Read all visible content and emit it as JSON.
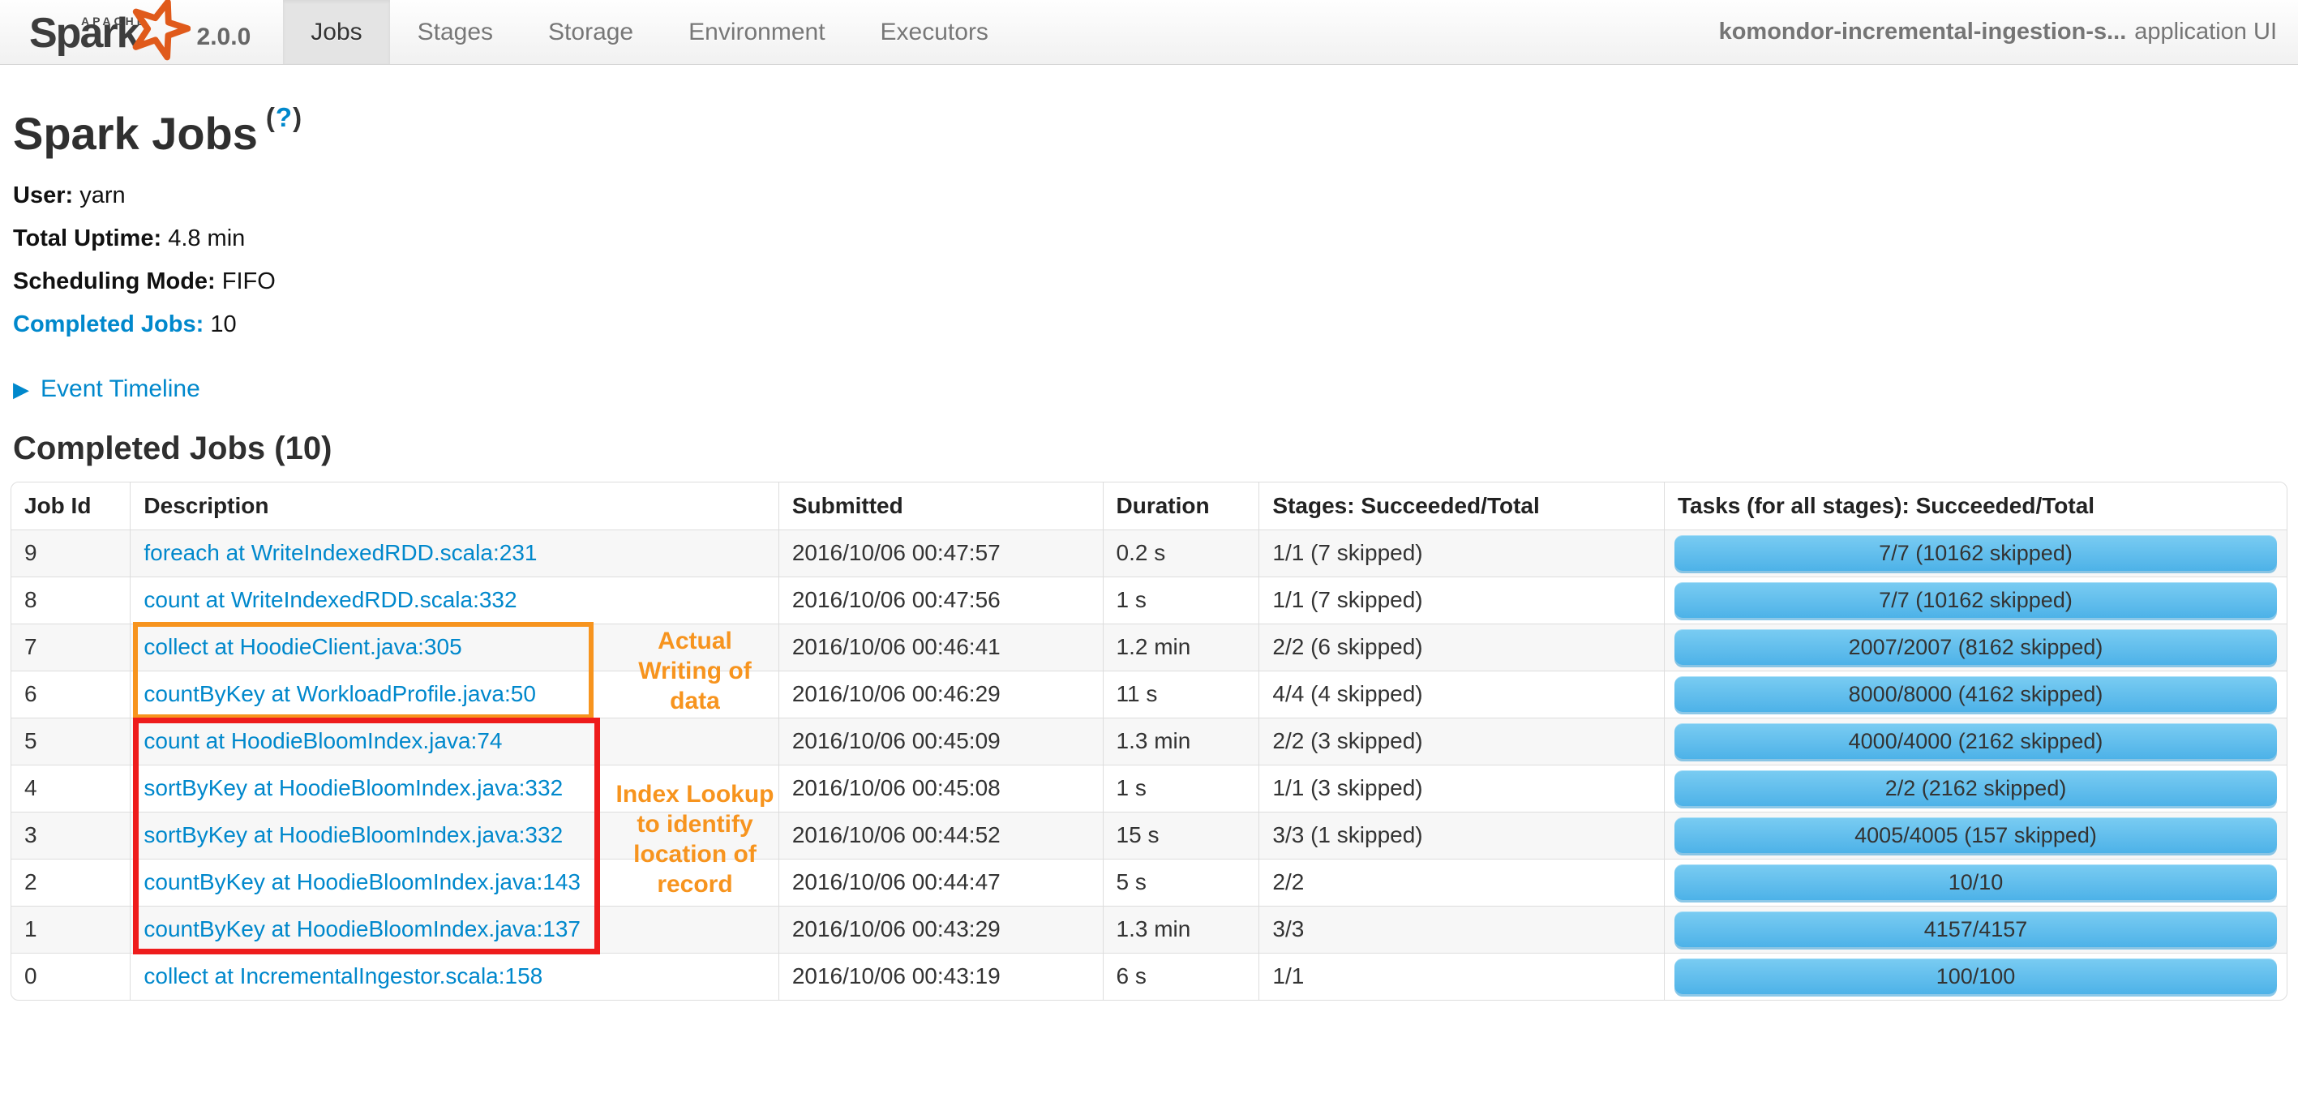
{
  "nav": {
    "logo": {
      "apache": "APACHE",
      "name": "Spark",
      "tm": "™",
      "version": "2.0.0"
    },
    "tabs": [
      {
        "label": "Jobs",
        "active": true
      },
      {
        "label": "Stages",
        "active": false
      },
      {
        "label": "Storage",
        "active": false
      },
      {
        "label": "Environment",
        "active": false
      },
      {
        "label": "Executors",
        "active": false
      }
    ],
    "app_name": "komondor-incremental-ingestion-s...",
    "app_suffix": "application UI"
  },
  "page": {
    "title": "Spark Jobs",
    "help": {
      "open": "(",
      "q": "?",
      "close": ")"
    },
    "info": {
      "user_label": "User:",
      "user_value": "yarn",
      "uptime_label": "Total Uptime:",
      "uptime_value": "4.8 min",
      "scheduling_label": "Scheduling Mode:",
      "scheduling_value": "FIFO",
      "completed_label": "Completed Jobs:",
      "completed_value": "10"
    },
    "event_timeline": {
      "arrow": "▶",
      "label": "Event Timeline"
    },
    "section_title": "Completed Jobs (10)"
  },
  "table": {
    "headers": [
      "Job Id",
      "Description",
      "Submitted",
      "Duration",
      "Stages: Succeeded/Total",
      "Tasks (for all stages): Succeeded/Total"
    ],
    "rows": [
      {
        "job_id": "9",
        "description": "foreach at WriteIndexedRDD.scala:231",
        "submitted": "2016/10/06 00:47:57",
        "duration": "0.2 s",
        "stages": "1/1 (7 skipped)",
        "tasks": "7/7 (10162 skipped)"
      },
      {
        "job_id": "8",
        "description": "count at WriteIndexedRDD.scala:332",
        "submitted": "2016/10/06 00:47:56",
        "duration": "1 s",
        "stages": "1/1 (7 skipped)",
        "tasks": "7/7 (10162 skipped)"
      },
      {
        "job_id": "7",
        "description": "collect at HoodieClient.java:305",
        "submitted": "2016/10/06 00:46:41",
        "duration": "1.2 min",
        "stages": "2/2 (6 skipped)",
        "tasks": "2007/2007 (8162 skipped)"
      },
      {
        "job_id": "6",
        "description": "countByKey at WorkloadProfile.java:50",
        "submitted": "2016/10/06 00:46:29",
        "duration": "11 s",
        "stages": "4/4 (4 skipped)",
        "tasks": "8000/8000 (4162 skipped)"
      },
      {
        "job_id": "5",
        "description": "count at HoodieBloomIndex.java:74",
        "submitted": "2016/10/06 00:45:09",
        "duration": "1.3 min",
        "stages": "2/2 (3 skipped)",
        "tasks": "4000/4000 (2162 skipped)"
      },
      {
        "job_id": "4",
        "description": "sortByKey at HoodieBloomIndex.java:332",
        "submitted": "2016/10/06 00:45:08",
        "duration": "1 s",
        "stages": "1/1 (3 skipped)",
        "tasks": "2/2 (2162 skipped)"
      },
      {
        "job_id": "3",
        "description": "sortByKey at HoodieBloomIndex.java:332",
        "submitted": "2016/10/06 00:44:52",
        "duration": "15 s",
        "stages": "3/3 (1 skipped)",
        "tasks": "4005/4005 (157 skipped)"
      },
      {
        "job_id": "2",
        "description": "countByKey at HoodieBloomIndex.java:143",
        "submitted": "2016/10/06 00:44:47",
        "duration": "5 s",
        "stages": "2/2",
        "tasks": "10/10"
      },
      {
        "job_id": "1",
        "description": "countByKey at HoodieBloomIndex.java:137",
        "submitted": "2016/10/06 00:43:29",
        "duration": "1.3 min",
        "stages": "3/3",
        "tasks": "4157/4157"
      },
      {
        "job_id": "0",
        "description": "collect at IncrementalIngestor.scala:158",
        "submitted": "2016/10/06 00:43:19",
        "duration": "6 s",
        "stages": "1/1",
        "tasks": "100/100"
      }
    ]
  },
  "annotations": {
    "writing": {
      "label": "Actual Writing of data",
      "color": "#f7941e"
    },
    "index_lookup": {
      "label": "Index Lookup to identify location of record",
      "color": "#f7941e",
      "box_color": "#ee1c1c"
    }
  },
  "colors": {
    "link": "#0088cc",
    "bar_top": "#7accf2",
    "bar_bottom": "#4db2e8",
    "orange_box": "#f7941e",
    "red_box": "#ee1c1c"
  }
}
